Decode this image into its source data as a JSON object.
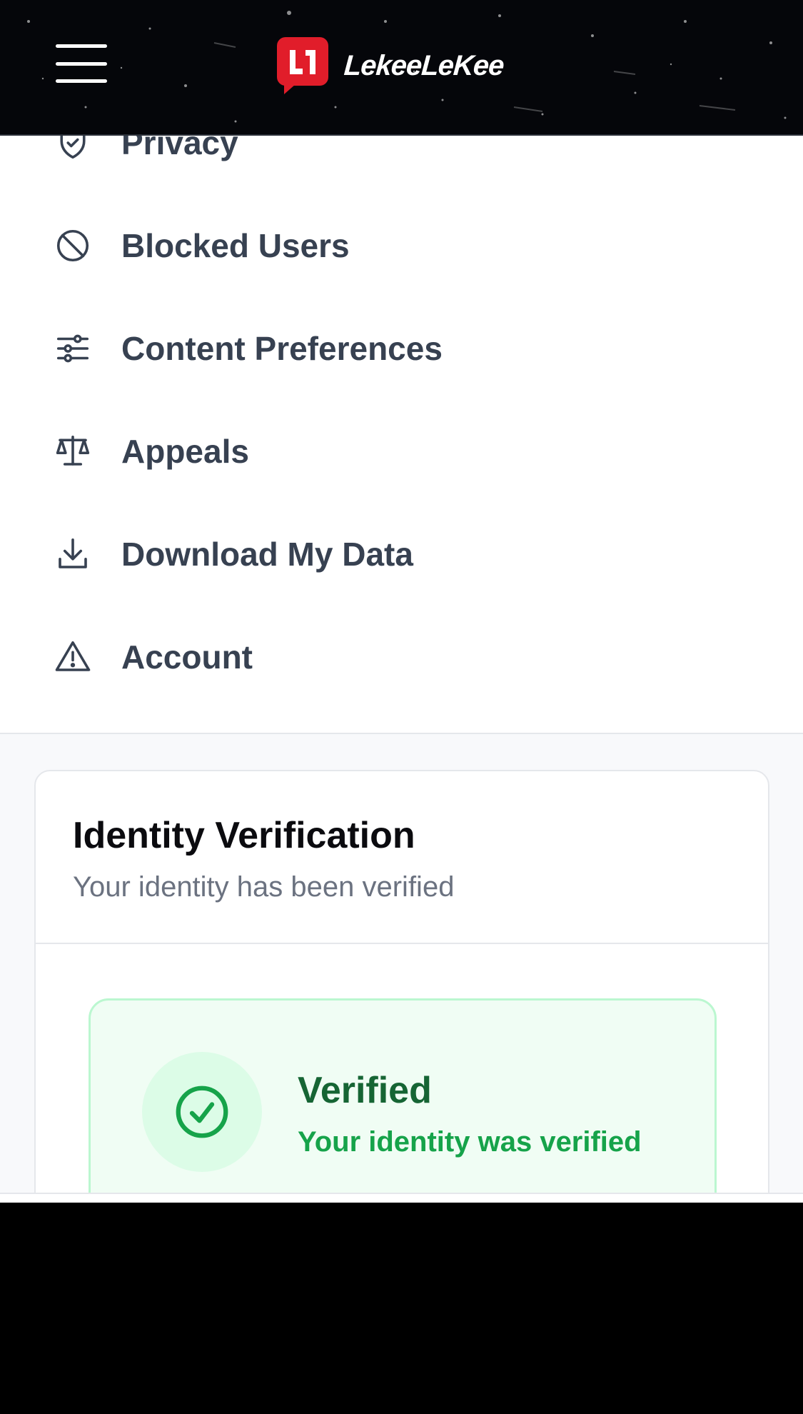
{
  "header": {
    "menu_icon": "hamburger-icon",
    "logo_mark_text": "L1",
    "logo_text": "LekeeLeKee",
    "logo_color": "#e11d2a"
  },
  "menu": {
    "items": [
      {
        "label": "Privacy",
        "icon": "shield-check-icon"
      },
      {
        "label": "Blocked Users",
        "icon": "ban-icon"
      },
      {
        "label": "Content Preferences",
        "icon": "sliders-icon"
      },
      {
        "label": "Appeals",
        "icon": "scale-icon"
      },
      {
        "label": "Download My Data",
        "icon": "download-icon"
      },
      {
        "label": "Account",
        "icon": "warning-triangle-icon"
      }
    ],
    "text_color": "#374151"
  },
  "identity": {
    "title": "Identity Verification",
    "subtitle": "Your identity has been verified",
    "status_title": "Verified",
    "status_text": "Your identity was verified",
    "status_icon": "check-circle-icon",
    "status_color": "#16a34a"
  }
}
